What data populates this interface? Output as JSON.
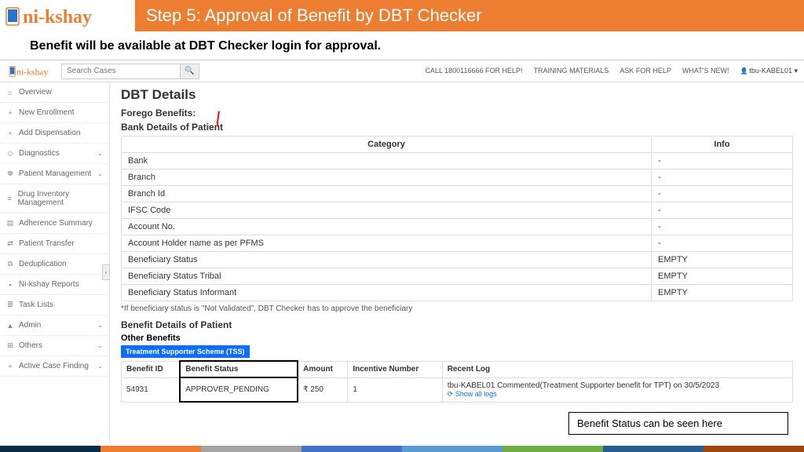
{
  "slide": {
    "title": "Step 5: Approval of  Benefit by DBT Checker",
    "subtitle": "Benefit will be available at DBT Checker login for approval.",
    "callout": "Benefit Status can be seen here"
  },
  "logo": {
    "text": "ni-kshay"
  },
  "topnav": {
    "search_placeholder": "Search Cases",
    "links": {
      "call": "CALL 1800116666 FOR HELP!",
      "training": "TRAINING MATERIALS",
      "ask": "ASK FOR HELP",
      "whatsnew": "WHAT'S NEW!",
      "user": "tbu-KABEL01"
    }
  },
  "sidebar": [
    {
      "icon": "⌂",
      "label": "Overview"
    },
    {
      "icon": "+",
      "label": "New Enrollment"
    },
    {
      "icon": "+",
      "label": "Add Dispensation"
    },
    {
      "icon": "◇",
      "label": "Diagnostics",
      "chev": true
    },
    {
      "icon": "☸",
      "label": "Patient Management",
      "chev": true
    },
    {
      "icon": "≡",
      "label": "Drug Inventory Management"
    },
    {
      "icon": "▤",
      "label": "Adherence Summary"
    },
    {
      "icon": "⇄",
      "label": "Patient Transfer"
    },
    {
      "icon": "⧉",
      "label": "Deduplication"
    },
    {
      "icon": "▪",
      "label": "Ni-kshay Reports"
    },
    {
      "icon": "≣",
      "label": "Task Lists"
    },
    {
      "icon": "▲",
      "label": "Admin",
      "chev": true
    },
    {
      "icon": "⊞",
      "label": "Others",
      "chev": true
    },
    {
      "icon": "+",
      "label": "Active Case Finding",
      "chev": true
    }
  ],
  "main": {
    "page_title": "DBT Details",
    "forego_label": "Forego Benefits:",
    "bank_section": "Bank Details of Patient",
    "bank_headers": {
      "cat": "Category",
      "info": "Info"
    },
    "bank_rows": [
      {
        "cat": "Bank",
        "info": "-"
      },
      {
        "cat": "Branch",
        "info": "-"
      },
      {
        "cat": "Branch Id",
        "info": "-"
      },
      {
        "cat": "IFSC Code",
        "info": "-"
      },
      {
        "cat": "Account No.",
        "info": "-"
      },
      {
        "cat": "Account Holder name as per PFMS",
        "info": "-"
      },
      {
        "cat": "Beneficiary Status",
        "info": "EMPTY"
      },
      {
        "cat": "Beneficiary Status Tribal",
        "info": "EMPTY"
      },
      {
        "cat": "Beneficiary Status Informant",
        "info": "EMPTY"
      }
    ],
    "note": "*If beneficiary status is \"Not Validated\", DBT Checker has to approve the beneficiary",
    "benefit_section": "Benefit Details of Patient",
    "other_label": "Other Benefits",
    "tss_badge": "Treatment Supporter Scheme (TSS)",
    "benefit_headers": {
      "id": "Benefit ID",
      "status": "Benefit Status",
      "amount": "Amount",
      "incentive": "Incentive Number",
      "log": "Recent Log"
    },
    "benefit_row": {
      "id": "54931",
      "status": "APPROVER_PENDING",
      "amount": "₹ 250",
      "incentive": "1",
      "log": "tbu-KABEL01   Commented(Treatment Supporter benefit for TPT)  on  30/5/2023",
      "show_logs": "Show all logs"
    }
  }
}
